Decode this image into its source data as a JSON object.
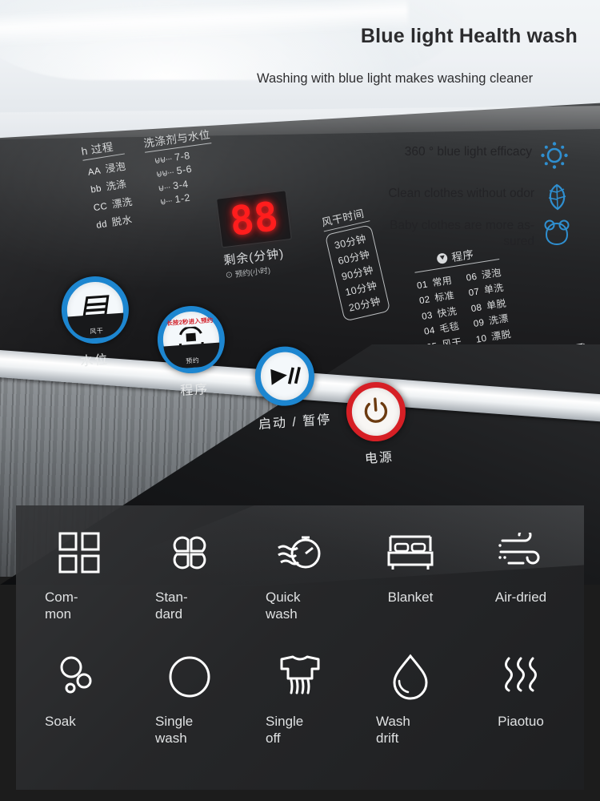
{
  "header": {
    "title": "Blue light Health wash",
    "subtitle": "Washing with blue light makes washing cleaner"
  },
  "features": [
    {
      "text": "360 ° blue light efficacy",
      "icon": "sun-rays-icon",
      "color": "#2f8fd0"
    },
    {
      "text": "Clean clothes without odor",
      "icon": "leaf-icon",
      "color": "#2f8fd0"
    },
    {
      "text": "Baby clothes are more as-sured",
      "icon": "baby-bear-icon",
      "color": "#2f8fd0"
    }
  ],
  "control_panel": {
    "process_legend": {
      "title": "h 过程",
      "rows": [
        {
          "code": "AA",
          "label": "浸泡"
        },
        {
          "code": "bb",
          "label": "洗涤"
        },
        {
          "code": "CC",
          "label": "漂洗"
        },
        {
          "code": "dd",
          "label": "脱水"
        }
      ]
    },
    "water_legend": {
      "title": "洗涤剂与水位",
      "rows": [
        {
          "marks": "⊌⊌···",
          "value": "7-8"
        },
        {
          "marks": "⊌⊌···",
          "value": "5-6"
        },
        {
          "marks": "⊌···",
          "value": "3-4"
        },
        {
          "marks": "⊌···",
          "value": "1-2"
        }
      ]
    },
    "display": {
      "value": "88",
      "label": "剩余(分钟)",
      "sublabel": "⊙ 预约(小时)"
    },
    "dry_legend": {
      "title": "风干时间",
      "rows": [
        "30分钟",
        "60分钟",
        "90分钟",
        "10分钟",
        "20分钟"
      ]
    },
    "program_legend": {
      "title": "程序",
      "left": [
        {
          "num": "01",
          "label": "常用"
        },
        {
          "num": "02",
          "label": "标准"
        },
        {
          "num": "03",
          "label": "快洗"
        },
        {
          "num": "04",
          "label": "毛毯"
        },
        {
          "num": "05",
          "label": "风干"
        }
      ],
      "right": [
        {
          "num": "06",
          "label": "浸泡"
        },
        {
          "num": "07",
          "label": "单洗"
        },
        {
          "num": "08",
          "label": "单脱"
        },
        {
          "num": "09",
          "label": "洗漂"
        },
        {
          "num": "10",
          "label": "漂脱"
        }
      ]
    },
    "buttons": [
      {
        "label": "水位",
        "icon": "water-level-icon",
        "ring": "#1d86d0",
        "sub": "风干"
      },
      {
        "label": "程序",
        "icon": "program-dial-icon",
        "ring": "#1d86d0",
        "sub": "预约",
        "arc_text": "长按2秒进入预约"
      },
      {
        "label": "启动 / 暂停",
        "icon": "play-pause-icon",
        "ring": "#1d86d0",
        "sub": ""
      },
      {
        "label": "电源",
        "icon": "power-icon",
        "ring": "#d61f25",
        "sub": ""
      }
    ]
  },
  "side_icons": [
    {
      "name": "diamond-icon"
    },
    {
      "name": "detergent-pour-icon"
    },
    {
      "name": "bucket-fan-icon"
    },
    {
      "name": "drum-icon"
    }
  ],
  "mode_grid": [
    {
      "icon": "four-squares-icon",
      "label": "Com-\nmon",
      "align": "left"
    },
    {
      "icon": "clover-icon",
      "label": "Stan-\ndard",
      "align": "left"
    },
    {
      "icon": "stopwatch-wave-icon",
      "label": "Quick\nwash",
      "align": "left"
    },
    {
      "icon": "bed-icon",
      "label": "Blanket",
      "align": "center"
    },
    {
      "icon": "wind-icon",
      "label": "Air-dried",
      "align": "center"
    },
    {
      "icon": "bubbles-icon",
      "label": "Soak",
      "align": "left"
    },
    {
      "icon": "circle-icon",
      "label": "Single\nwash",
      "align": "left"
    },
    {
      "icon": "shirt-drip-icon",
      "label": "Single\noff",
      "align": "left"
    },
    {
      "icon": "water-drop-icon",
      "label": "Wash\ndrift",
      "align": "left"
    },
    {
      "icon": "steam-waves-icon",
      "label": "Piaotuo",
      "align": "center"
    }
  ],
  "colors": {
    "accent_blue": "#1d86d0",
    "power_red": "#d61f25",
    "led_red": "#ff1d1d",
    "panel_dark": "#232426"
  }
}
